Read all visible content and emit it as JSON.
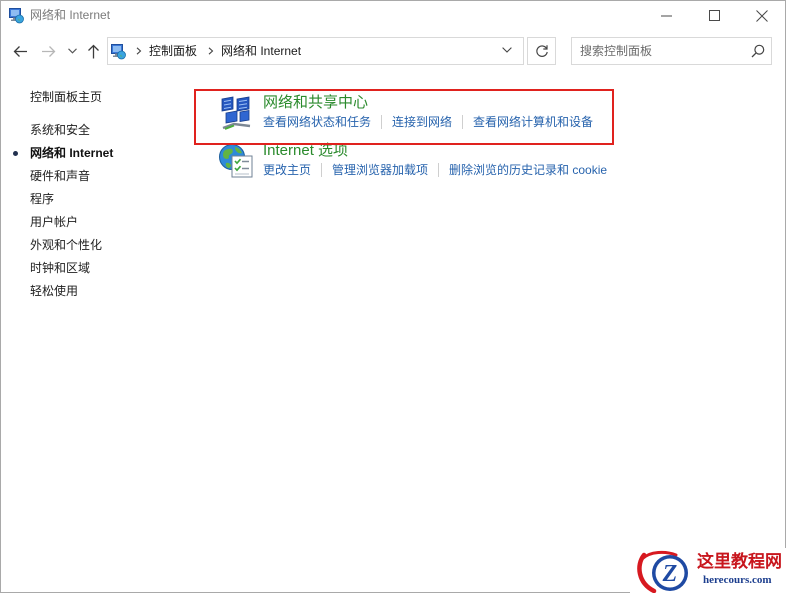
{
  "window": {
    "title": "网络和 Internet",
    "app_icon": "network-internet-icon",
    "controls": [
      "minimize-icon",
      "maximize-icon",
      "close-icon"
    ]
  },
  "navigation": {
    "buttons": [
      "back-arrow-icon",
      "forward-arrow-icon",
      "recent-locations-chevron-icon",
      "up-arrow-icon"
    ],
    "forward_enabled": false,
    "breadcrumb": [
      {
        "label": "控制面板"
      },
      {
        "label": "网络和 Internet"
      }
    ],
    "refresh_icon": "refresh-icon",
    "search": {
      "placeholder": "搜索控制面板",
      "value": "",
      "icon": "search-icon"
    }
  },
  "sidebar": {
    "home_link": "控制面板主页",
    "items": [
      {
        "label": "系统和安全",
        "selected": false
      },
      {
        "label": "网络和 Internet",
        "selected": true
      },
      {
        "label": "硬件和声音",
        "selected": false
      },
      {
        "label": "程序",
        "selected": false
      },
      {
        "label": "用户帐户",
        "selected": false
      },
      {
        "label": "外观和个性化",
        "selected": false
      },
      {
        "label": "时钟和区域",
        "selected": false
      },
      {
        "label": "轻松使用",
        "selected": false
      }
    ]
  },
  "categories": [
    {
      "title": "网络和共享中心",
      "icon": "network-sharing-center-icon",
      "highlighted": true,
      "links": [
        "查看网络状态和任务",
        "连接到网络",
        "查看网络计算机和设备"
      ]
    },
    {
      "title": "Internet 选项",
      "icon": "internet-options-icon",
      "highlighted": false,
      "links": [
        "更改主页",
        "管理浏览器加载项",
        "删除浏览的历史记录和 cookie"
      ]
    }
  ],
  "colors": {
    "category_title": "#2a8a2c",
    "link": "#2763ad",
    "highlight_box": "#e0221e",
    "watermark_name": "#c8161d",
    "watermark_domain": "#1c3e8e"
  },
  "watermark": {
    "logo_letter": "Z",
    "name": "这里教程网",
    "domain": "herecours.com"
  }
}
